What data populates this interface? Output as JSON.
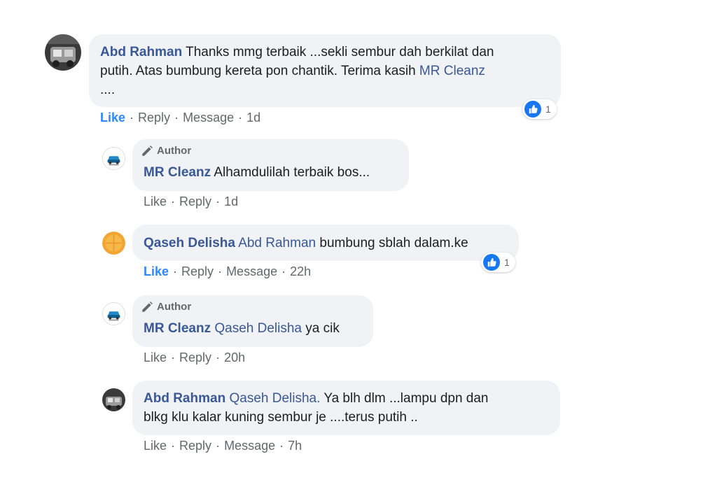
{
  "comments": [
    {
      "author": "Abd Rahman",
      "text_1": "Thanks mmg terbaik ...sekli sembur dah berkilat dan",
      "text_2": "putih. Atas bumbung kereta pon chantik. Terima kasih",
      "mention": "MR Cleanz",
      "text_3": "....",
      "actions": {
        "like": "Like",
        "reply": "Reply",
        "message": "Message",
        "time": "1d",
        "sep": "·"
      },
      "reaction_count": "1",
      "avatar_icon": "user-photo-icon"
    },
    {
      "author_badge": "Author",
      "author": "MR Cleanz",
      "text": "Alhamdulilah terbaik bos...",
      "actions": {
        "like": "Like",
        "reply": "Reply",
        "time": "1d",
        "sep": "·"
      },
      "avatar_icon": "car-logo-icon"
    },
    {
      "author": "Qaseh Delisha",
      "mention": "Abd Rahman",
      "text": "bumbung sblah dalam.ke",
      "actions": {
        "like": "Like",
        "reply": "Reply",
        "message": "Message",
        "time": "22h",
        "sep": "·"
      },
      "reaction_count": "1",
      "avatar_icon": "orange-circle-icon"
    },
    {
      "author_badge": "Author",
      "author": "MR Cleanz",
      "mention": "Qaseh Delisha",
      "text": "ya cik",
      "actions": {
        "like": "Like",
        "reply": "Reply",
        "time": "20h",
        "sep": "·"
      },
      "avatar_icon": "car-logo-icon"
    },
    {
      "author": "Abd Rahman",
      "mention": "Qaseh Delisha.",
      "text_1": "Ya blh dlm ...lampu dpn dan",
      "text_2": "blkg klu kalar kuning sembur je ....terus putih ..",
      "actions": {
        "like": "Like",
        "reply": "Reply",
        "message": "Message",
        "time": "7h",
        "sep": "·"
      },
      "avatar_icon": "user-photo-icon"
    }
  ],
  "colors": {
    "name": "#385898",
    "bubble": "#f0f2f5",
    "muted": "#65676b",
    "like_active": "#2d88ff",
    "like_badge": "#1877f2"
  }
}
